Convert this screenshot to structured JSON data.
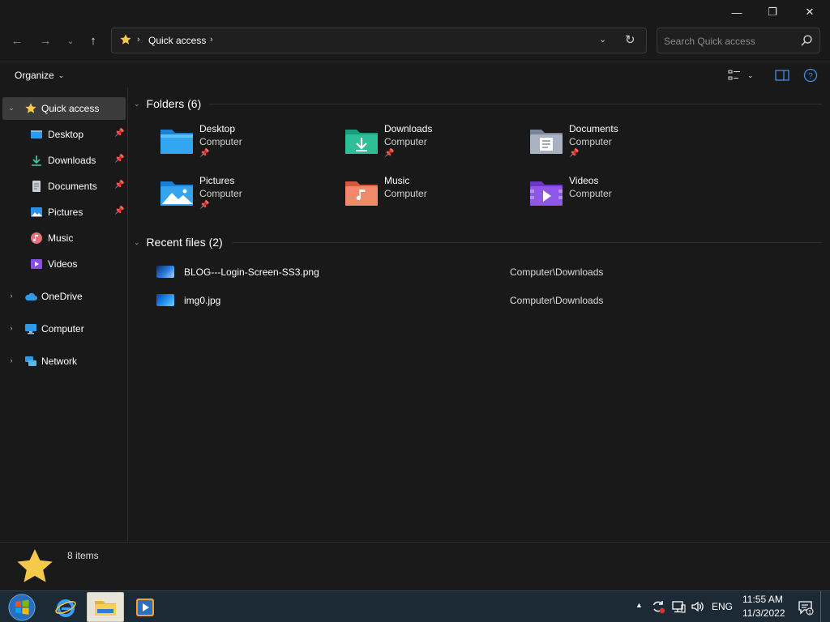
{
  "window": {
    "controls": {
      "minimize": "—",
      "maximize": "❐",
      "close": "✕"
    }
  },
  "nav": {
    "back_icon": "←",
    "forward_icon": "→",
    "recent_icon": "⌄",
    "up_icon": "↑"
  },
  "address": {
    "location": "Quick access",
    "separator": "›",
    "dropdown_icon": "⌄",
    "refresh_icon": "↻"
  },
  "search": {
    "placeholder": "Search Quick access",
    "value": ""
  },
  "commandbar": {
    "organize_label": "Organize",
    "chevron": "⌄"
  },
  "sidebar": {
    "items": [
      {
        "label": "Quick access",
        "icon": "star-icon",
        "expander": "⌄",
        "selected": true
      },
      {
        "label": "Desktop",
        "icon": "desktop-icon",
        "pinned": "📌"
      },
      {
        "label": "Downloads",
        "icon": "downloads-icon",
        "pinned": "📌"
      },
      {
        "label": "Documents",
        "icon": "documents-icon",
        "pinned": "📌"
      },
      {
        "label": "Pictures",
        "icon": "pictures-icon",
        "pinned": "📌"
      },
      {
        "label": "Music",
        "icon": "music-icon"
      },
      {
        "label": "Videos",
        "icon": "videos-icon"
      },
      {
        "label": "OneDrive",
        "icon": "onedrive-icon",
        "expander": "›"
      },
      {
        "label": "Computer",
        "icon": "computer-icon",
        "expander": "›"
      },
      {
        "label": "Network",
        "icon": "network-icon",
        "expander": "›"
      }
    ],
    "pin_glyph": "📌"
  },
  "folders": {
    "header": "Folders (6)",
    "chevron": "⌄",
    "items": [
      {
        "name": "Desktop",
        "location": "Computer",
        "pinned": true,
        "icon": "desktop-folder-icon"
      },
      {
        "name": "Downloads",
        "location": "Computer",
        "pinned": true,
        "icon": "downloads-folder-icon"
      },
      {
        "name": "Documents",
        "location": "Computer",
        "pinned": true,
        "icon": "documents-folder-icon"
      },
      {
        "name": "Pictures",
        "location": "Computer",
        "pinned": true,
        "icon": "pictures-folder-icon"
      },
      {
        "name": "Music",
        "location": "Computer",
        "pinned": false,
        "icon": "music-folder-icon"
      },
      {
        "name": "Videos",
        "location": "Computer",
        "pinned": false,
        "icon": "videos-folder-icon"
      }
    ]
  },
  "recent": {
    "header": "Recent files (2)",
    "chevron": "⌄",
    "items": [
      {
        "name": "BLOG---Login-Screen-SS3.png",
        "location": "Computer\\Downloads"
      },
      {
        "name": "img0.jpg",
        "location": "Computer\\Downloads"
      }
    ]
  },
  "status": {
    "item_count": "8 items"
  },
  "taskbar": {
    "apps": [
      "internet-explorer-icon",
      "file-explorer-icon",
      "media-player-icon"
    ],
    "tray": {
      "arrow": "▲",
      "language": "ENG",
      "time": "11:55 AM",
      "date": "11/3/2022",
      "notification_count": "1"
    }
  },
  "colors": {
    "background": "#191919",
    "selected": "#3b3b3b",
    "star": "#f7c948",
    "taskbar": "#1c2a36"
  }
}
